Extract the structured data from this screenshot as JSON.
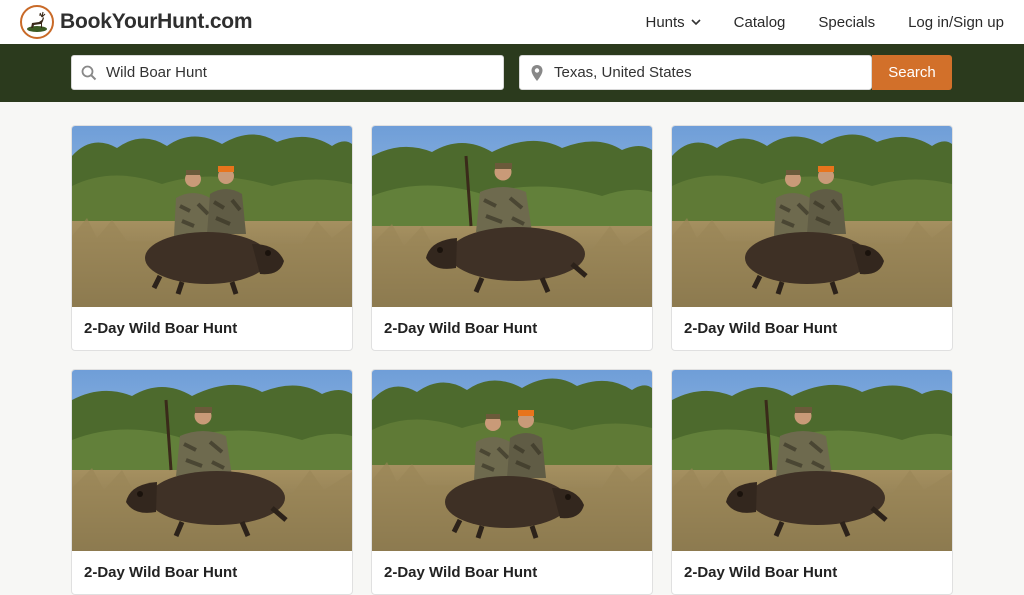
{
  "brand": {
    "name": "BookYourHunt.com",
    "logo_icon": "deer-icon",
    "accent": "#c96a28"
  },
  "nav": {
    "items": [
      {
        "label": "Hunts",
        "has_dropdown": true
      },
      {
        "label": "Catalog"
      },
      {
        "label": "Specials"
      },
      {
        "label": "Log in/Sign up"
      }
    ]
  },
  "search": {
    "what_value": "Wild Boar Hunt",
    "where_value": "Texas, United States",
    "button_label": "Search",
    "bar_color": "#2b3a1d",
    "button_color": "#d2702a"
  },
  "listings": [
    {
      "title": "2-Day Wild Boar Hunt",
      "photo": "two-hunters-with-boar"
    },
    {
      "title": "2-Day Wild Boar Hunt",
      "photo": "hunter-with-rifle-and-boar"
    },
    {
      "title": "2-Day Wild Boar Hunt",
      "photo": "two-hunters-with-boar"
    },
    {
      "title": "2-Day Wild Boar Hunt",
      "photo": "hunter-with-rifle-and-boar"
    },
    {
      "title": "2-Day Wild Boar Hunt",
      "photo": "two-hunters-with-boar-and-rifle"
    },
    {
      "title": "2-Day Wild Boar Hunt",
      "photo": "hunter-with-rifle-and-boar"
    }
  ]
}
